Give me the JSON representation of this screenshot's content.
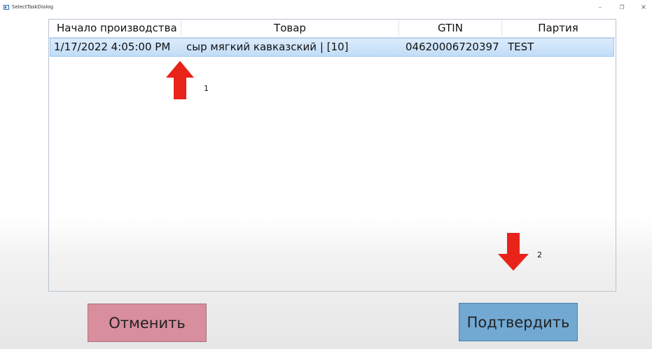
{
  "window": {
    "title": "SelectTaskDialog",
    "controls": {
      "minimize": "–",
      "maximize": "❐",
      "close": "×"
    }
  },
  "table": {
    "columns": [
      "Начало производства",
      "Товар",
      "GTIN",
      "Партия"
    ],
    "rows": [
      {
        "start": "1/17/2022 4:05:00 PM",
        "product": "сыр мягкий кавказский | [10]",
        "gtin": "04620006720397",
        "batch": "TEST"
      }
    ]
  },
  "annotations": {
    "marker_1": "1",
    "marker_2": "2",
    "arrow_color": "#e8231a"
  },
  "buttons": {
    "cancel": "Отменить",
    "confirm": "Подтвердить"
  },
  "colors": {
    "selected_row": "#c8e0f8",
    "cancel_button": "#d98e9d",
    "confirm_button": "#72a9d3"
  }
}
